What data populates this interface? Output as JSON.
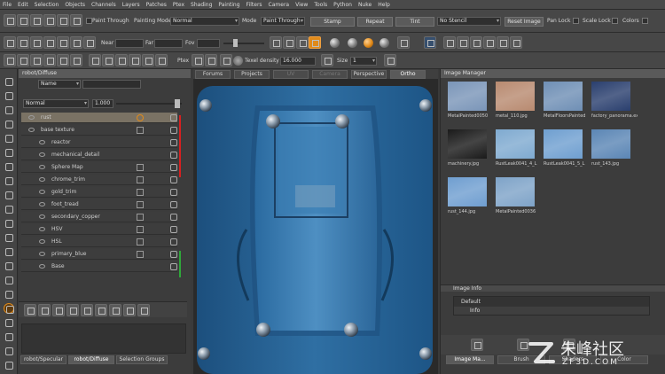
{
  "menu": [
    "File",
    "Edit",
    "Selection",
    "Objects",
    "Channels",
    "Layers",
    "Patches",
    "Ptex",
    "Shading",
    "Painting",
    "Filters",
    "Camera",
    "View",
    "Tools",
    "Python",
    "Nuke",
    "Help"
  ],
  "toolbar1": {
    "paint_through": "Paint Through",
    "painting_mode_label": "Painting Mode",
    "painting_mode_value": "Normal",
    "mode_label": "Mode",
    "mode_value": "Paint Through",
    "stamp": "Stamp",
    "repeat": "Repeat",
    "tint": "Tint",
    "stencil_value": "No Stencil",
    "reset_image": "Reset Image",
    "pan_lock": "Pan Lock",
    "scale_lock": "Scale Lock",
    "colors": "Colors"
  },
  "toolbar2": {
    "near": "Near",
    "far": "Far",
    "fov": "Fov"
  },
  "toolbar3": {
    "ptex": "Ptex",
    "texel_density": "Texel density",
    "texel_value": "16.000",
    "size": "Size",
    "size_value": "1"
  },
  "left_panel": {
    "title": "robot/Diffuse",
    "blend_mode": "Normal",
    "top_combo": "Name",
    "opacity": "1.000",
    "layers": [
      {
        "name": "rust",
        "selected": true,
        "indent": 0
      },
      {
        "name": "base texture",
        "selected": false,
        "indent": 0
      },
      {
        "name": "reactor",
        "selected": false,
        "indent": 1
      },
      {
        "name": "mechanical_detail",
        "selected": false,
        "indent": 1
      },
      {
        "name": "Sphere Map",
        "selected": false,
        "indent": 1
      },
      {
        "name": "chrome_trim",
        "selected": false,
        "indent": 1
      },
      {
        "name": "gold_trim",
        "selected": false,
        "indent": 1
      },
      {
        "name": "foot_tread",
        "selected": false,
        "indent": 1
      },
      {
        "name": "secondary_copper",
        "selected": false,
        "indent": 1
      },
      {
        "name": "HSV",
        "selected": false,
        "indent": 1
      },
      {
        "name": "HSL",
        "selected": false,
        "indent": 1
      },
      {
        "name": "primary_blue",
        "selected": false,
        "indent": 1
      },
      {
        "name": "Base",
        "selected": false,
        "indent": 1
      }
    ],
    "tabs": [
      "robot/Specular",
      "robot/Diffuse",
      "Selection Groups"
    ]
  },
  "viewport": {
    "tabs": [
      "Forums",
      "Projects",
      "UV",
      "Camera",
      "Perspective",
      "Ortho"
    ],
    "active_tab": "Ortho"
  },
  "image_manager": {
    "title": "Image Manager",
    "thumbs": [
      {
        "caption": "MetalPainted0050",
        "color": "#7a95b8"
      },
      {
        "caption": "metal_110.jpg",
        "color": "#b88a70"
      },
      {
        "caption": "MetalFloorsPainted",
        "color": "#6f8fb5"
      },
      {
        "caption": "factory_panorama.exr",
        "color": "#2a3f6e"
      },
      {
        "caption": "machinery.jpg",
        "color": "#1a1a1a"
      },
      {
        "caption": "RustLeak0041_4_L",
        "color": "#7faad0"
      },
      {
        "caption": "RustLeak0041_5_L",
        "color": "#6f9fd0"
      },
      {
        "caption": "rust_143.jpg",
        "color": "#5b86b5"
      },
      {
        "caption": "rust_144.jpg",
        "color": "#6f9ed0"
      },
      {
        "caption": "MetalPainted0036",
        "color": "#7ea3c8"
      }
    ],
    "info_title": "Image Info",
    "info_rows": [
      "Default",
      "Info"
    ],
    "tabs": [
      "Image Ma...",
      "Brush",
      "Shaders",
      "Color"
    ]
  },
  "watermark": {
    "text": "朱峰社区",
    "url": "ZF3D.COM"
  },
  "colors": {
    "accent": "#e08a1a",
    "green": "#2fa83a",
    "red": "#d82020"
  }
}
